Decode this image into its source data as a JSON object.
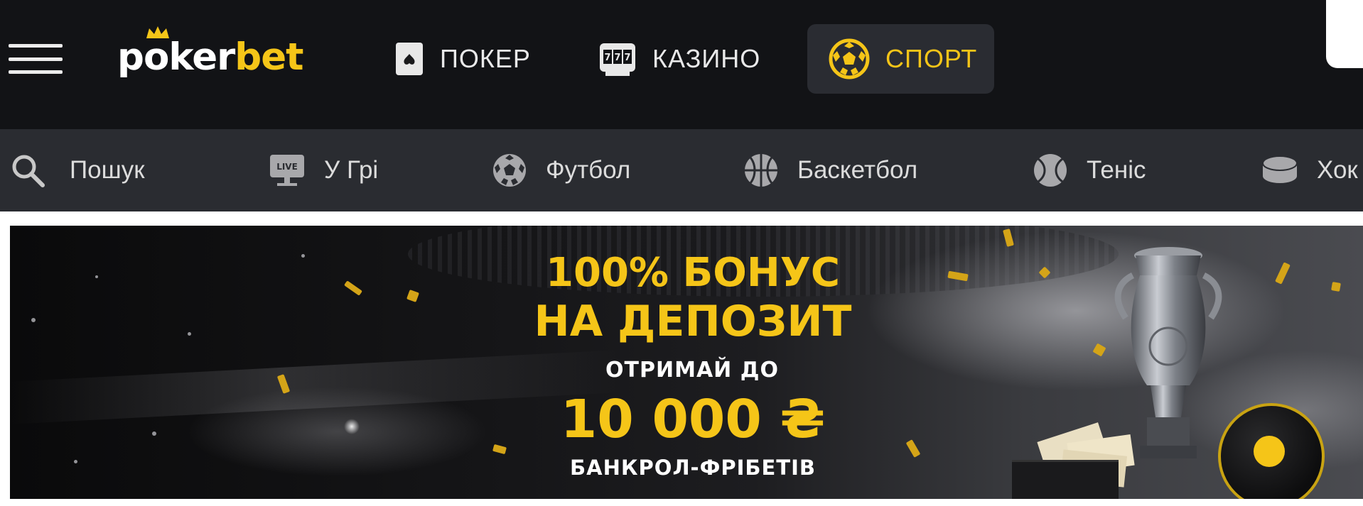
{
  "header": {
    "logo": {
      "part1": "p",
      "part2": "o",
      "part3": "ker",
      "part4": "bet"
    },
    "tabs": [
      {
        "id": "poker",
        "label": "ПОКЕР",
        "icon": "playing-card-icon"
      },
      {
        "id": "casino",
        "label": "КАЗИНО",
        "icon": "slot-machine-icon"
      },
      {
        "id": "sport",
        "label": "СПОРТ",
        "icon": "soccer-ball-icon",
        "active": true
      }
    ]
  },
  "subnav": {
    "items": [
      {
        "id": "search",
        "label": "Пошук",
        "icon": "search-icon"
      },
      {
        "id": "live",
        "label": "У Грі",
        "icon": "live-tv-icon",
        "icon_text": "LIVE"
      },
      {
        "id": "football",
        "label": "Футбол",
        "icon": "football-icon"
      },
      {
        "id": "basketball",
        "label": "Баскетбол",
        "icon": "basketball-icon"
      },
      {
        "id": "tennis",
        "label": "Теніс",
        "icon": "tennis-ball-icon"
      },
      {
        "id": "hockey",
        "label": "Хок",
        "icon": "hockey-puck-icon"
      }
    ]
  },
  "banner": {
    "line1": "100% БОНУС",
    "line2": "НА ДЕПОЗИТ",
    "line3": "ОТРИМАЙ ДО",
    "line4": "10 000 ₴",
    "line5": "БАНКРОЛ-ФРІБЕТІВ"
  },
  "colors": {
    "brand_yellow": "#f5c518",
    "header_bg": "#121316",
    "subnav_bg": "#2a2c31",
    "active_tab_bg": "#2a2c32"
  }
}
